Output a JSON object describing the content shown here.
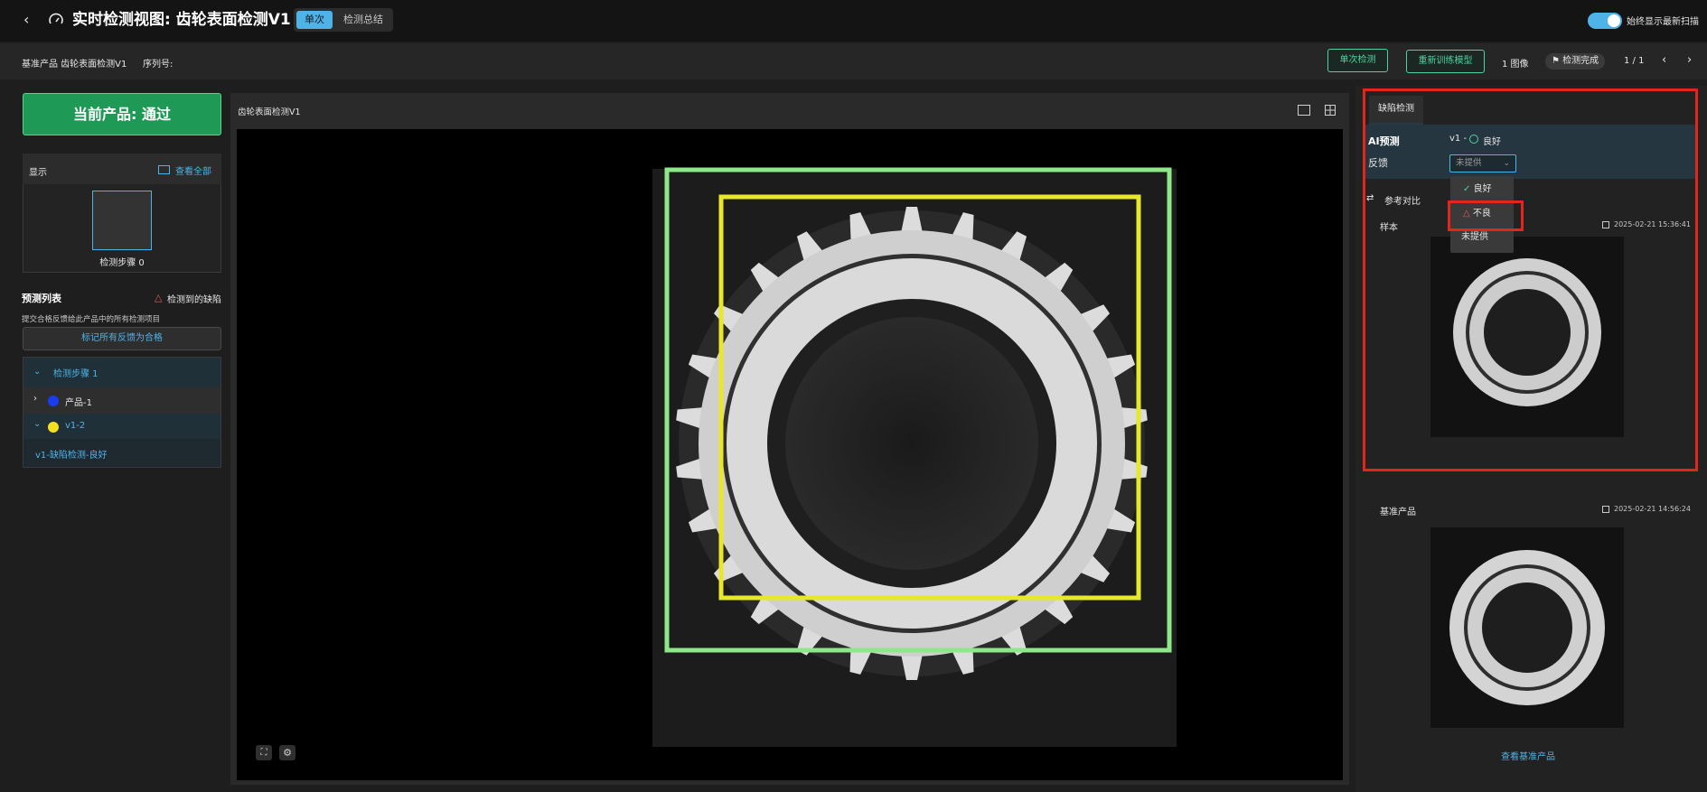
{
  "header": {
    "title": "实时检测视图: 齿轮表面检测V1",
    "mode_tabs": [
      "单次",
      "检测总结"
    ],
    "auto_show_latest": "始终显示最新扫描"
  },
  "subbar": {
    "base_product": "基准产品 齿轮表面检测V1",
    "serial_label": "序列号:",
    "single_detect_button": "单次检测",
    "retrain_button": "重新训练模型",
    "image_count": "1 图像",
    "status_badge": "检测完成",
    "pagination": "1 / 1"
  },
  "left_panel": {
    "result_button": "当前产品: 通过",
    "display_label": "显示",
    "view_all": "查看全部",
    "step_thumb_label": "检测步骤 0",
    "prediction_list_title": "预测列表",
    "detected_defect_label": "检测到的缺陷",
    "hint_text": "提交合格反馈给此产品中的所有检测项目",
    "mark_all_button": "标记所有反馈为合格",
    "tree": [
      {
        "label": "检测步骤 1",
        "expanded": true
      },
      {
        "label": "产品-1",
        "dot_color": "#1a3cf0"
      },
      {
        "label": "v1-2",
        "dot_color": "#f5e020"
      },
      {
        "label": "v1-缺陷检测-良好"
      }
    ]
  },
  "viewer": {
    "title": "齿轮表面检测V1",
    "boxes": [
      {
        "name": "outer-box",
        "color": "#8ee88a"
      },
      {
        "name": "inner-box",
        "color": "#e8e82a"
      }
    ]
  },
  "right_panel": {
    "tab": "缺陷检测",
    "ai_prediction_label": "AI预测",
    "ai_prediction_value": "v1 -",
    "ai_prediction_result": "良好",
    "feedback_label": "反馈",
    "feedback_selected": "未提供",
    "feedback_options": [
      "良好",
      "不良",
      "未提供"
    ],
    "reference_compare": "参考对比",
    "sample_label": "样本",
    "sample_time": "2025-02-21 15:36:41",
    "base_product_label": "基准产品",
    "base_time": "2025-02-21 14:56:24",
    "view_base_product": "查看基准产品"
  },
  "colors": {
    "accent": "#4fb3e8",
    "pass_green": "#1f9a56",
    "highlight_red": "#e3261c"
  }
}
